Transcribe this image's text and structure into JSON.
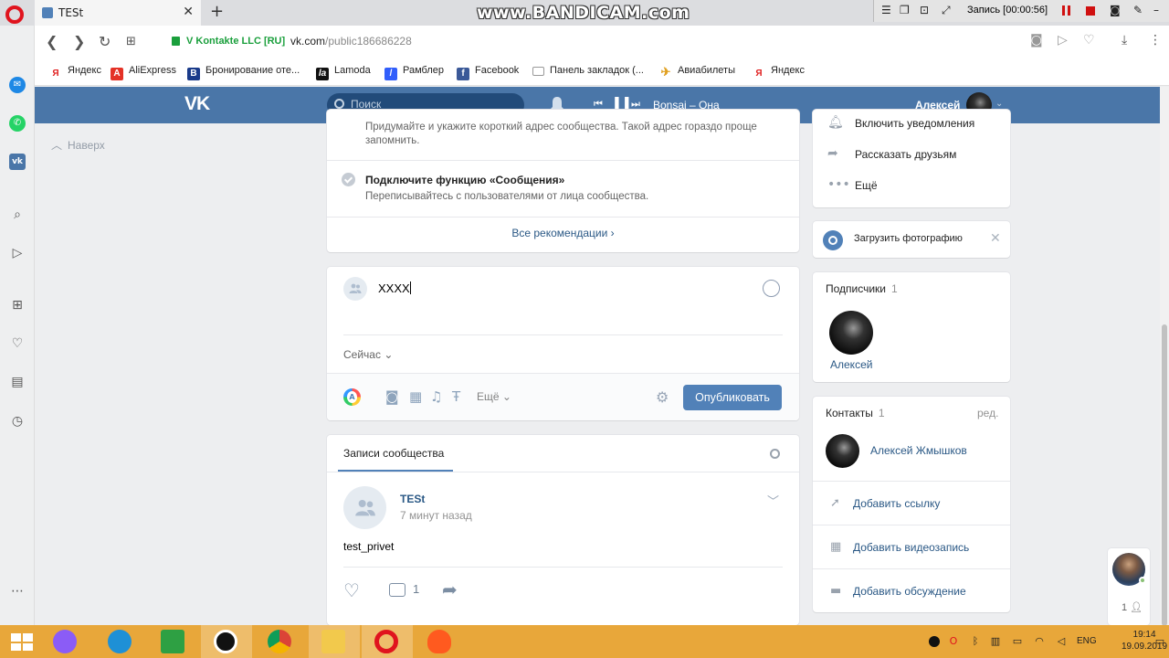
{
  "browser": {
    "tab_title": "TESt",
    "tab_close": "✕",
    "new_tab": "+",
    "site_name": "V Kontakte LLC [RU]",
    "url_host": "vk.com",
    "url_path": "/public186686228",
    "bookmarks": [
      "Яндекс",
      "AliExpress",
      "Бронирование оте...",
      "Lamoda",
      "Рамблер",
      "Facebook",
      "Панель закладок (...",
      "Авиабилеты",
      "Яндекс"
    ]
  },
  "recorder": {
    "watermark": "www.BANDICAM.com",
    "status": "Запись [00:00:56]"
  },
  "vk_header": {
    "logo": "VK",
    "search_placeholder": "Поиск",
    "track": "Bonsai – Она",
    "user_name": "Алексей"
  },
  "back_to_top": "Наверх",
  "recommendations": {
    "item1_desc": "Придумайте и укажите короткий адрес сообщества. Такой адрес гораздо проще запомнить.",
    "item2_title": "Подключите функцию «Сообщения»",
    "item2_desc": "Переписывайтесь с пользователями от лица сообщества.",
    "all_link": "Все рекомендации ›"
  },
  "composer": {
    "text": "XXXX",
    "time": "Сейчас",
    "more": "Ещё",
    "publish": "Опубликовать"
  },
  "wall": {
    "tab": "Записи сообщества",
    "post": {
      "author": "TESt",
      "time": "7 минут назад",
      "text": "test_privet",
      "comments": "1"
    }
  },
  "sidebar_actions": {
    "notifications": "Включить уведомления",
    "tell_friends": "Рассказать друзьям",
    "more": "Ещё"
  },
  "upload_photo": "Загрузить фотографию",
  "subscribers": {
    "title": "Подписчики",
    "count": "1",
    "name": "Алексей"
  },
  "contacts": {
    "title": "Контакты",
    "count": "1",
    "edit": "ред.",
    "name": "Алексей Жмышков",
    "add_link": "Добавить ссылку",
    "add_video": "Добавить видеозапись",
    "add_discussion": "Добавить обсуждение"
  },
  "chat": {
    "count": "1"
  },
  "taskbar": {
    "lang": "ENG",
    "time": "19:14",
    "date": "19.09.2019"
  },
  "colors": {
    "vk_blue": "#4a76a8",
    "vk_button": "#5181b8",
    "link": "#2a5885",
    "taskbar": "#e8a73a"
  }
}
